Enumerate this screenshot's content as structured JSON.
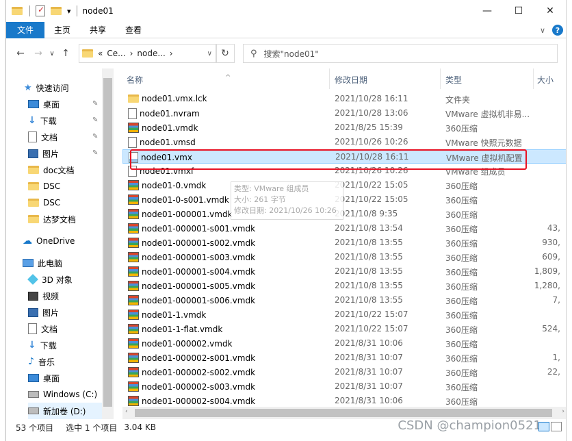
{
  "window": {
    "title": "node01",
    "minimize": "—",
    "maximize": "☐",
    "close": "✕",
    "qat_dropdown": "▾"
  },
  "ribbon": {
    "tabs": [
      "文件",
      "主页",
      "共享",
      "查看"
    ],
    "collapse": "∨",
    "help": "?"
  },
  "address": {
    "back": "←",
    "forward": "→",
    "recent": "∨",
    "up": "↑",
    "crumbs": [
      "«",
      "Ce...",
      "›",
      "node...",
      "›"
    ],
    "dropdown": "∨",
    "refresh": "↻",
    "search_placeholder": "搜索\"node01\""
  },
  "nav": {
    "items": [
      {
        "label": "快速访问",
        "icon": "star-icon",
        "pinned": false
      },
      {
        "label": "桌面",
        "icon": "desktop-icon",
        "pinned": true
      },
      {
        "label": "下载",
        "icon": "download-icon",
        "pinned": true
      },
      {
        "label": "文档",
        "icon": "document-icon",
        "pinned": true
      },
      {
        "label": "图片",
        "icon": "picture-icon",
        "pinned": true
      },
      {
        "label": "doc文档",
        "icon": "folder-icon",
        "pinned": false
      },
      {
        "label": "DSC",
        "icon": "folder-icon",
        "pinned": false
      },
      {
        "label": "DSC",
        "icon": "folder-icon",
        "pinned": false
      },
      {
        "label": "达梦文档",
        "icon": "folder-icon",
        "pinned": false
      },
      {
        "label": "OneDrive",
        "icon": "cloud-icon",
        "pinned": false
      },
      {
        "label": "此电脑",
        "icon": "computer-icon",
        "pinned": false
      },
      {
        "label": "3D 对象",
        "icon": "cube-icon",
        "pinned": false
      },
      {
        "label": "视频",
        "icon": "video-icon",
        "pinned": false
      },
      {
        "label": "图片",
        "icon": "picture-icon",
        "pinned": false
      },
      {
        "label": "文档",
        "icon": "document-icon",
        "pinned": false
      },
      {
        "label": "下载",
        "icon": "download-icon",
        "pinned": false
      },
      {
        "label": "音乐",
        "icon": "music-icon",
        "pinned": false
      },
      {
        "label": "桌面",
        "icon": "desktop-icon",
        "pinned": false
      },
      {
        "label": "Windows (C:)",
        "icon": "drive-icon",
        "pinned": false
      },
      {
        "label": "新加卷 (D:)",
        "icon": "drive-icon",
        "pinned": false
      }
    ],
    "pin_glyph": "📌"
  },
  "columns": {
    "name": "名称",
    "modified": "修改日期",
    "type": "类型",
    "size": "大小"
  },
  "files": [
    {
      "name": "node01.vmx.lck",
      "date": "2021/10/28 16:11",
      "type": "文件夹",
      "size": "",
      "icon": "folder-icon"
    },
    {
      "name": "node01.nvram",
      "date": "2021/10/28 13:06",
      "type": "VMware 虚拟机非易...",
      "size": "",
      "icon": "vmware-file-icon"
    },
    {
      "name": "node01.vmdk",
      "date": "2021/8/25 15:39",
      "type": "360压缩",
      "size": "",
      "icon": "archive-icon"
    },
    {
      "name": "node01.vmsd",
      "date": "2021/10/26 10:26",
      "type": "VMware 快照元数据",
      "size": "",
      "icon": "vmware-file-icon"
    },
    {
      "name": "node01.vmx",
      "date": "2021/10/28 16:11",
      "type": "VMware 虚拟机配置",
      "size": "",
      "icon": "vmware-config-icon",
      "selected": true
    },
    {
      "name": "node01.vmxf",
      "date": "2021/10/26 10:26",
      "type": "VMware 组成员",
      "size": "",
      "icon": "vmware-file-icon"
    },
    {
      "name": "node01-0.vmdk",
      "date": "2021/10/22 15:05",
      "type": "360压缩",
      "size": "",
      "icon": "archive-icon"
    },
    {
      "name": "node01-0-s001.vmdk",
      "date": "2021/10/22 15:05",
      "type": "360压缩",
      "size": "",
      "icon": "archive-icon"
    },
    {
      "name": "node01-000001.vmdk",
      "date": "2021/10/8 9:35",
      "type": "360压缩",
      "size": "",
      "icon": "archive-icon"
    },
    {
      "name": "node01-000001-s001.vmdk",
      "date": "2021/10/8 13:54",
      "type": "360压缩",
      "size": "43,",
      "icon": "archive-icon"
    },
    {
      "name": "node01-000001-s002.vmdk",
      "date": "2021/10/8 13:55",
      "type": "360压缩",
      "size": "930,",
      "icon": "archive-icon"
    },
    {
      "name": "node01-000001-s003.vmdk",
      "date": "2021/10/8 13:55",
      "type": "360压缩",
      "size": "609,",
      "icon": "archive-icon"
    },
    {
      "name": "node01-000001-s004.vmdk",
      "date": "2021/10/8 13:55",
      "type": "360压缩",
      "size": "1,809,",
      "icon": "archive-icon"
    },
    {
      "name": "node01-000001-s005.vmdk",
      "date": "2021/10/8 13:55",
      "type": "360压缩",
      "size": "1,280,",
      "icon": "archive-icon"
    },
    {
      "name": "node01-000001-s006.vmdk",
      "date": "2021/10/8 13:55",
      "type": "360压缩",
      "size": "7,",
      "icon": "archive-icon"
    },
    {
      "name": "node01-1.vmdk",
      "date": "2021/10/22 15:07",
      "type": "360压缩",
      "size": "",
      "icon": "archive-icon"
    },
    {
      "name": "node01-1-flat.vmdk",
      "date": "2021/10/22 15:07",
      "type": "360压缩",
      "size": "524,",
      "icon": "archive-icon"
    },
    {
      "name": "node01-000002.vmdk",
      "date": "2021/8/31 10:06",
      "type": "360压缩",
      "size": "",
      "icon": "archive-icon"
    },
    {
      "name": "node01-000002-s001.vmdk",
      "date": "2021/8/31 10:07",
      "type": "360压缩",
      "size": "1,",
      "icon": "archive-icon"
    },
    {
      "name": "node01-000002-s002.vmdk",
      "date": "2021/8/31 10:07",
      "type": "360压缩",
      "size": "22,",
      "icon": "archive-icon"
    },
    {
      "name": "node01-000002-s003.vmdk",
      "date": "2021/8/31 10:07",
      "type": "360压缩",
      "size": "",
      "icon": "archive-icon"
    },
    {
      "name": "node01-000002-s004.vmdk",
      "date": "2021/8/31 10:06",
      "type": "360压缩",
      "size": "",
      "icon": "archive-icon"
    }
  ],
  "tooltip": {
    "line1": "类型: VMware 组成员",
    "line2": "大小: 261 字节",
    "line3": "修改日期: 2021/10/26 10:26"
  },
  "status": {
    "count": "53 个项目",
    "selection": "选中 1 个项目",
    "size": "3.04 KB"
  },
  "watermark": "CSDN @champion0521",
  "scroll": {
    "left": "‹",
    "right": "›"
  },
  "colors": {
    "accent": "#1979ca",
    "selection": "#cce8ff",
    "highlight_box": "#e81123"
  }
}
